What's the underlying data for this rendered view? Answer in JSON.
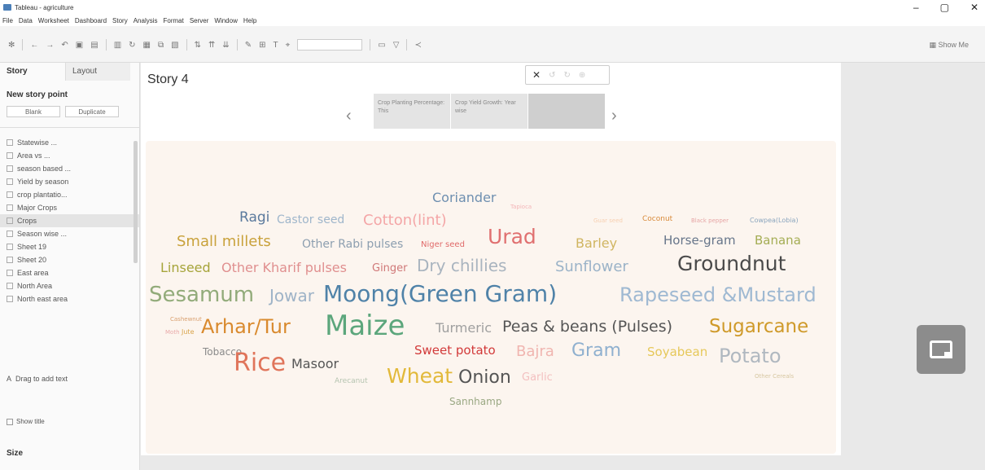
{
  "window": {
    "title": "Tableau - agriculture",
    "controls": [
      "–",
      "▢",
      "✕"
    ]
  },
  "menu": [
    "File",
    "Data",
    "Worksheet",
    "Dashboard",
    "Story",
    "Analysis",
    "Format",
    "Server",
    "Window",
    "Help"
  ],
  "toolbar": {
    "show_me": "Show Me"
  },
  "left_panel": {
    "tabs": [
      "Story",
      "Layout"
    ],
    "new_story_point": "New story point",
    "blank_label": "Blank",
    "duplicate_label": "Duplicate",
    "sheets": [
      "Statewise ...",
      "Area vs ...",
      "season based ...",
      "Yield by season",
      "crop plantatio...",
      "Major Crops",
      "Crops",
      "Season wise ...",
      "Sheet 19",
      "Sheet 20",
      "East area",
      "North Area",
      "North east area"
    ],
    "active_sheet_index": 6,
    "drag_text": "Drag to add text",
    "show_title": "Show title",
    "size_label": "Size"
  },
  "story": {
    "title": "Story 4",
    "points": [
      {
        "caption": "Crop Planting Percentage: This"
      },
      {
        "caption": "Crop Yield Growth: Year wise"
      },
      {
        "caption": ""
      }
    ],
    "popup_close": "✕"
  },
  "wordcloud": [
    {
      "text": "Coriander",
      "color": "#6e8fb0"
    },
    {
      "text": "Tapioca",
      "color": "#f3b5b8"
    },
    {
      "text": "Ragi",
      "color": "#5b7a9d"
    },
    {
      "text": "Castor seed",
      "color": "#9fb6cb"
    },
    {
      "text": "Cotton(lint)",
      "color": "#f4a6a7"
    },
    {
      "text": "Guar seed",
      "color": "#f7cfb0"
    },
    {
      "text": "Coconut",
      "color": "#d88a3a"
    },
    {
      "text": "Black pepper",
      "color": "#e6a5a5"
    },
    {
      "text": "Cowpea(Lobia)",
      "color": "#8aa5be"
    },
    {
      "text": "Small millets",
      "color": "#c9a23c"
    },
    {
      "text": "Other Rabi pulses",
      "color": "#8d9fb0"
    },
    {
      "text": "Niger seed",
      "color": "#e06a6a"
    },
    {
      "text": "Urad",
      "color": "#e07070"
    },
    {
      "text": "Barley",
      "color": "#d0b561"
    },
    {
      "text": "Horse-gram",
      "color": "#66758a"
    },
    {
      "text": "Banana",
      "color": "#a4ad54"
    },
    {
      "text": "Linseed",
      "color": "#a6a43a"
    },
    {
      "text": "Other Kharif pulses",
      "color": "#e08f8f"
    },
    {
      "text": "Ginger",
      "color": "#d07878"
    },
    {
      "text": "Dry chillies",
      "color": "#a9b4bf"
    },
    {
      "text": "Sunflower",
      "color": "#9bb3c8"
    },
    {
      "text": "Groundnut",
      "color": "#4a4a4a"
    },
    {
      "text": "Sesamum",
      "color": "#92ab7a"
    },
    {
      "text": "Jowar",
      "color": "#9eb3c7"
    },
    {
      "text": "Moong(Green Gram)",
      "color": "#4f82a8"
    },
    {
      "text": "Rapeseed &Mustard",
      "color": "#9fb9d2"
    },
    {
      "text": "Cashewnut",
      "color": "#d9a070"
    },
    {
      "text": "Moth",
      "color": "#e9a9a9"
    },
    {
      "text": "Jute",
      "color": "#d9a44a"
    },
    {
      "text": "Arhar/Tur",
      "color": "#d98a2e"
    },
    {
      "text": "Maize",
      "color": "#5ca67c"
    },
    {
      "text": "Turmeric",
      "color": "#a0a0a0"
    },
    {
      "text": "Peas & beans (Pulses)",
      "color": "#555555"
    },
    {
      "text": "Sugarcane",
      "color": "#cf9a2a"
    },
    {
      "text": "Tobacco",
      "color": "#8a8a8a"
    },
    {
      "text": "Rice",
      "color": "#e0745a"
    },
    {
      "text": "Masoor",
      "color": "#555555"
    },
    {
      "text": "Sweet potato",
      "color": "#d23a3a"
    },
    {
      "text": "Bajra",
      "color": "#f0b5b0"
    },
    {
      "text": "Gram",
      "color": "#8fb0cf"
    },
    {
      "text": "Soyabean",
      "color": "#e6c85a"
    },
    {
      "text": "Potato",
      "color": "#b0b8c0"
    },
    {
      "text": "Arecanut",
      "color": "#b5c4b0"
    },
    {
      "text": "Wheat",
      "color": "#e2b93a"
    },
    {
      "text": "Onion",
      "color": "#555555"
    },
    {
      "text": "Garlic",
      "color": "#f3c0c0"
    },
    {
      "text": "Other Cereals",
      "color": "#d6c6a0"
    },
    {
      "text": "Sannhamp",
      "color": "#9aa883"
    }
  ]
}
